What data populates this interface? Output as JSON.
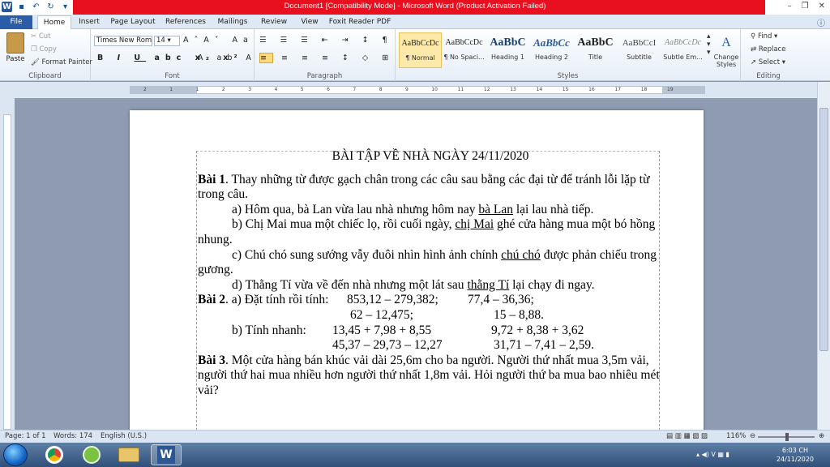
{
  "window": {
    "title": "Document1 [Compatibility Mode] - Microsoft Word (Product Activation Failed)"
  },
  "tabs": [
    "File",
    "Home",
    "Insert",
    "Page Layout",
    "References",
    "Mailings",
    "Review",
    "View",
    "Foxit Reader PDF"
  ],
  "clipboard": {
    "paste": "Paste",
    "cut": "Cut",
    "copy": "Copy",
    "format_painter": "Format Painter",
    "label": "Clipboard"
  },
  "font": {
    "name": "Times New Rom",
    "size": "14",
    "label": "Font"
  },
  "paragraph": {
    "label": "Paragraph"
  },
  "styles": {
    "label": "Styles",
    "items": [
      {
        "preview": "AaBbCcDc",
        "name": "¶ Normal"
      },
      {
        "preview": "AaBbCcDc",
        "name": "¶ No Spaci..."
      },
      {
        "preview": "AaBbC",
        "name": "Heading 1"
      },
      {
        "preview": "AaBbCc",
        "name": "Heading 2"
      },
      {
        "preview": "AaBbC",
        "name": "Title"
      },
      {
        "preview": "AaBbCcI",
        "name": "Subtitle"
      },
      {
        "preview": "AaBbCcDc",
        "name": "Subtle Em..."
      }
    ],
    "change_styles": "Change Styles"
  },
  "editing": {
    "find": "Find",
    "replace": "Replace",
    "select": "Select",
    "label": "Editing"
  },
  "ruler_numbers": [
    "2",
    "1",
    "1",
    "2",
    "3",
    "4",
    "5",
    "6",
    "7",
    "8",
    "9",
    "10",
    "11",
    "12",
    "13",
    "14",
    "15",
    "16",
    "17",
    "18",
    "19"
  ],
  "document": {
    "title": "BÀI TẬP VỀ  NHÀ NGÀY 24/11/2020",
    "b1_label": "Bài 1",
    "b1_text": ". Thay những từ được gạch chân trong các câu sau bằng các đại từ để tránh lỗi lặp từ trong câu.",
    "a_pre": "a) Hôm qua, bà Lan vừa lau nhà nhưng hôm nay ",
    "a_u": "bà Lan",
    "a_post": " lại lau nhà tiếp.",
    "b_pre": "b) Chị Mai mua một chiếc lọ, rồi cuối ngày, ",
    "b_u": "chị Mai",
    "b_post": " ghé cửa hàng mua một bó hồng nhung.",
    "c_pre": "c) Chú chó sung sướng vẫy đuôi nhìn hình ảnh chính ",
    "c_u": "chú chó",
    "c_post": " được phản chiếu trong gương.",
    "d_pre": "d) Thằng Tí vừa về đến nhà nhưng một lát sau ",
    "d_u": "thằng Tí",
    "d_post": " lại chạy đi ngay.",
    "b2_label": "Bài 2",
    "b2_a": ". a) Đặt tính rồi tính:",
    "e1": "853,12 – 279,382;",
    "e2": "77,4 – 36,36;",
    "e3": "62 – 12,475;",
    "e4": "15 – 8,88.",
    "b2_b": "b) Tính nhanh:",
    "e5": "13,45 + 7,98 + 8,55",
    "e6": "9,72 + 8,38 + 3,62",
    "e7": "45,37 – 29,73 – 12,27",
    "e8": "31,71 – 7,41 – 2,59.",
    "b3_label": "Bài 3",
    "b3_text": ". Một cửa hàng bán khúc vải dài 25,6m cho ba người. Người thứ nhất mua 3,5m vải, người thứ hai mua nhiều hơn người thứ nhất 1,8m vải. Hỏi người thứ ba mua bao nhiêu mét vải?"
  },
  "status": {
    "page": "Page: 1 of 1",
    "words": "Words: 174",
    "language": "English (U.S.)",
    "zoom": "116%"
  },
  "taskbar": {
    "time": "6:03 CH",
    "date": "24/11/2020"
  },
  "colors": {
    "titlebar_red": "#e8101e",
    "file_tab": "#2a5ca8"
  }
}
